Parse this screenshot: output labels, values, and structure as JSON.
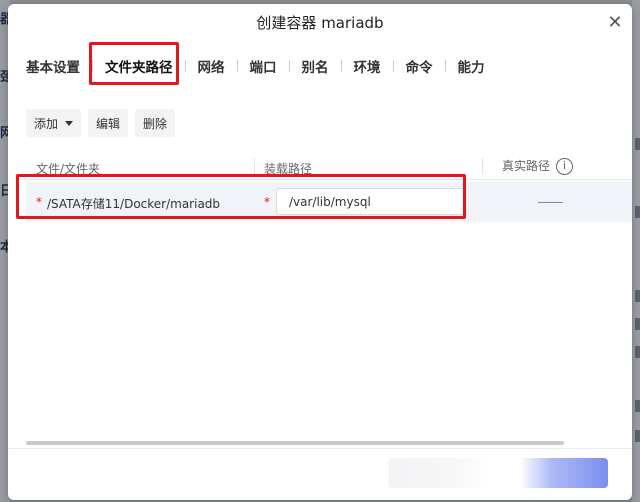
{
  "dialog": {
    "title": "创建容器 mariadb",
    "close_glyph": "✕"
  },
  "tabs": [
    {
      "label": "基本设置"
    },
    {
      "label": "文件夹路径",
      "active": true
    },
    {
      "label": "网络"
    },
    {
      "label": "端口"
    },
    {
      "label": "别名"
    },
    {
      "label": "环境"
    },
    {
      "label": "命令"
    },
    {
      "label": "能力"
    }
  ],
  "toolbar": {
    "add_label": "添加",
    "edit_label": "编辑",
    "delete_label": "删除"
  },
  "table": {
    "headers": {
      "file_folder": "文件/文件夹",
      "mount_path": "装载路径",
      "real_path": "真实路径"
    },
    "rows": [
      {
        "file_folder": "/SATA存储11/Docker/mariadb",
        "mount_path": "/var/lib/mysql",
        "real_path": "——",
        "required_mark": "*"
      }
    ]
  },
  "background": {
    "left_fragments": [
      "器",
      "颈",
      "网",
      "日",
      "本"
    ]
  },
  "colors": {
    "highlight": "#e0191e",
    "primary": "#7b8ef0"
  },
  "icons": {
    "close": "close-icon",
    "info": "info-icon",
    "dropdown": "caret-down-icon"
  }
}
